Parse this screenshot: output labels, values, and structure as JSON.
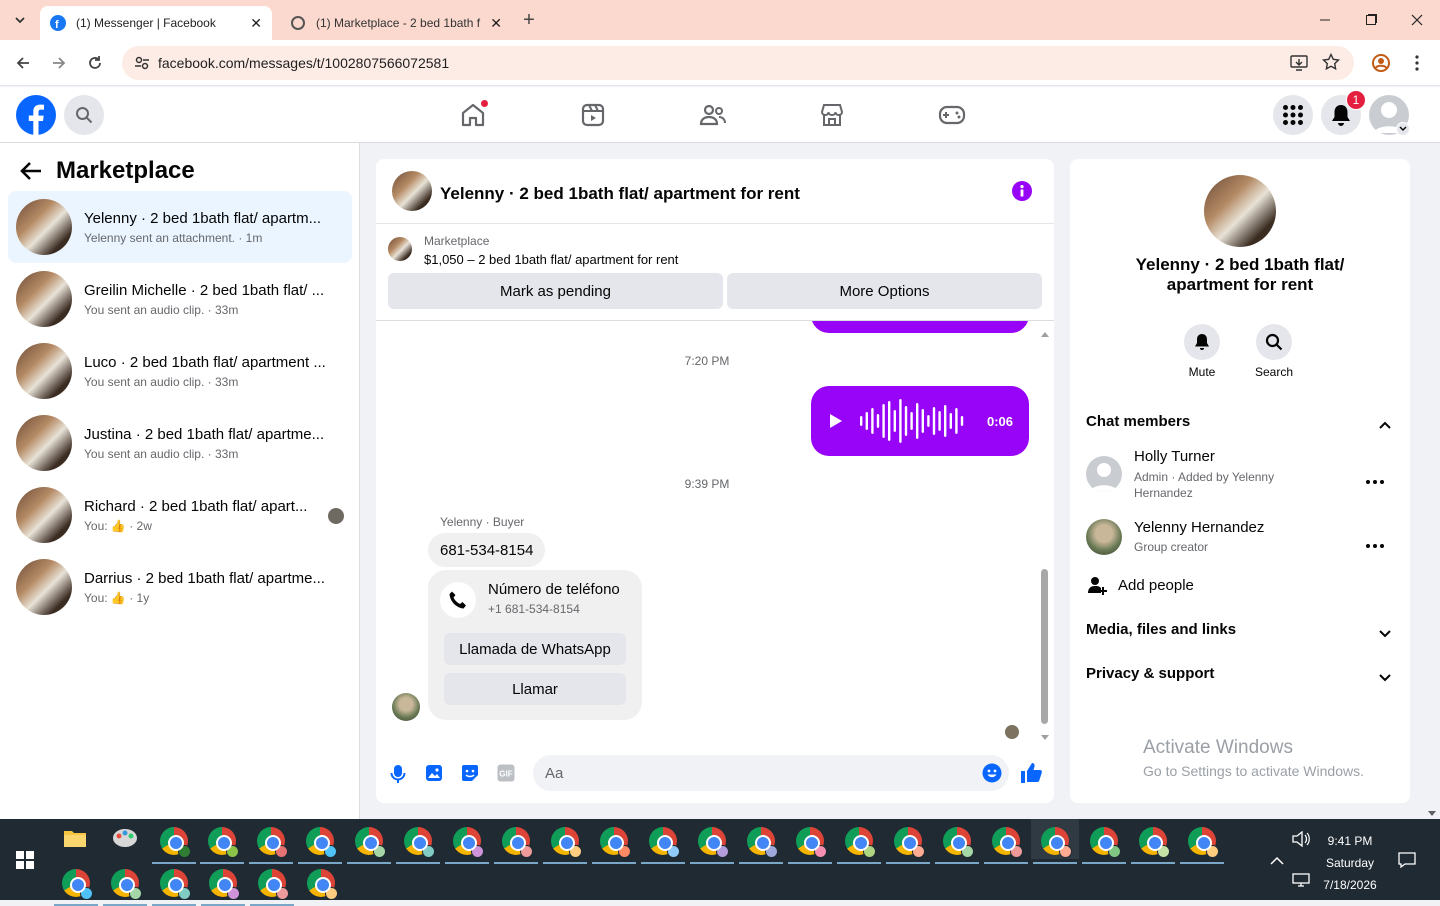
{
  "browser": {
    "tabs": [
      {
        "title": "(1) Messenger | Facebook",
        "active": true
      },
      {
        "title": "(1) Marketplace - 2 bed 1bath f",
        "active": false
      }
    ],
    "url": "facebook.com/messages/t/1002807566072581"
  },
  "header": {
    "notif_count": "1"
  },
  "left": {
    "title": "Marketplace",
    "conversations": [
      {
        "name": "Yelenny · 2 bed 1bath flat/ apartm...",
        "preview": "Yelenny sent an attachment. · 1m"
      },
      {
        "name": "Greilin Michelle · 2 bed 1bath flat/ ...",
        "preview": "You sent an audio clip. · 33m"
      },
      {
        "name": "Luco · 2 bed 1bath flat/ apartment ...",
        "preview": "You sent an audio clip. · 33m"
      },
      {
        "name": "Justina · 2 bed 1bath flat/ apartme...",
        "preview": "You sent an audio clip. · 33m"
      },
      {
        "name": "Richard · 2 bed 1bath flat/ apart...",
        "preview": "You: 👍 · 2w"
      },
      {
        "name": "Darrius · 2 bed 1bath flat/ apartme...",
        "preview": "You: 👍 · 1y"
      }
    ]
  },
  "chat": {
    "title": "Yelenny · 2 bed 1bath flat/ apartment for rent",
    "listing_source": "Marketplace",
    "listing_text": "$1,050 – 2 bed 1bath flat/ apartment for rent",
    "mark_pending": "Mark as pending",
    "more_options": "More Options",
    "time1": "7:20 PM",
    "audio_duration": "0:06",
    "time2": "9:39 PM",
    "sender_label": "Yelenny · Buyer",
    "phone_message": "681-534-8154",
    "card_title": "Número de teléfono",
    "card_number": "+1 681-534-8154",
    "whatsapp_btn": "Llamada de WhatsApp",
    "call_btn": "Llamar",
    "input_placeholder": "Aa"
  },
  "right": {
    "title": "Yelenny · 2 bed 1bath flat/ apartment for rent",
    "mute": "Mute",
    "search": "Search",
    "chat_members": "Chat members",
    "members": [
      {
        "name": "Holly Turner",
        "role": "Admin · Added by Yelenny Hernandez"
      },
      {
        "name": "Yelenny Hernandez",
        "role": "Group creator"
      }
    ],
    "add_people": "Add people",
    "media": "Media, files and links",
    "privacy": "Privacy & support"
  },
  "watermark": {
    "line1": "Activate Windows",
    "line2": "Go to Settings to activate Windows."
  },
  "taskbar": {
    "time": "9:41 PM",
    "day": "Saturday",
    "date": "7/18/2026"
  }
}
